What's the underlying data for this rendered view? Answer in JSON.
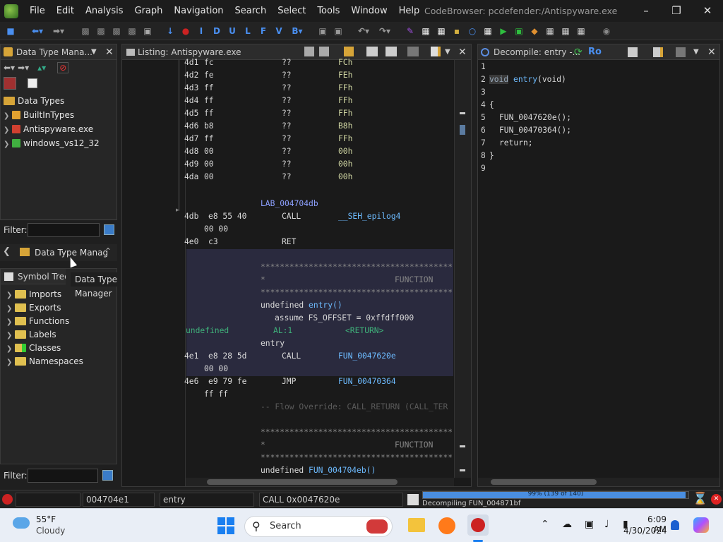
{
  "menubar": {
    "items": [
      "File",
      "Edit",
      "Analysis",
      "Graph",
      "Navigation",
      "Search",
      "Select",
      "Tools",
      "Window",
      "Help"
    ],
    "window_title": "CodeBrowser: pcdefender:/Antispyware.exe"
  },
  "data_type_panel": {
    "title": "Data Type Mana...",
    "root": "Data Types",
    "items": [
      "BuiltInTypes",
      "Antispyware.exe",
      "windows_vs12_32"
    ],
    "filter_label": "Filter:",
    "tab_label": "Data Type Manag",
    "tooltip": "Data Type Manager"
  },
  "symbol_tree": {
    "title": "Symbol Tree",
    "items": [
      "Imports",
      "Exports",
      "Functions",
      "Labels",
      "Classes",
      "Namespaces"
    ],
    "filter_label": "Filter:"
  },
  "listing": {
    "title": "Listing:  Antispyware.exe",
    "rows": [
      {
        "addr": "4d1",
        "bytes": "fc",
        "mn": "??",
        "op": "FCh"
      },
      {
        "addr": "4d2",
        "bytes": "fe",
        "mn": "??",
        "op": "FEh"
      },
      {
        "addr": "4d3",
        "bytes": "ff",
        "mn": "??",
        "op": "FFh"
      },
      {
        "addr": "4d4",
        "bytes": "ff",
        "mn": "??",
        "op": "FFh"
      },
      {
        "addr": "4d5",
        "bytes": "ff",
        "mn": "??",
        "op": "FFh"
      },
      {
        "addr": "4d6",
        "bytes": "b8",
        "mn": "??",
        "op": "B8h"
      },
      {
        "addr": "4d7",
        "bytes": "ff",
        "mn": "??",
        "op": "FFh"
      },
      {
        "addr": "4d8",
        "bytes": "00",
        "mn": "??",
        "op": "00h"
      },
      {
        "addr": "4d9",
        "bytes": "00",
        "mn": "??",
        "op": "00h"
      },
      {
        "addr": "4da",
        "bytes": "00",
        "mn": "??",
        "op": "00h"
      }
    ],
    "label1": "LAB_004704db",
    "call1": {
      "addr": "4db",
      "bytes": "e8 55 40",
      "bytes2": "00 00",
      "mn": "CALL",
      "op": "__SEH_epilog4"
    },
    "ret": {
      "addr": "4e0",
      "bytes": "c3",
      "mn": "RET"
    },
    "stars": "********************************************",
    "function_word": "FUNCTION",
    "sig_type": "undefined",
    "sig_name": "entry()",
    "assume": "assume FS_OFFSET = 0xffdff000",
    "ret_type": "undefined",
    "ret_reg": "AL:1",
    "ret_tag": "<RETURN>",
    "entry_label": "entry",
    "call2": {
      "addr": "4e1",
      "bytes": "e8 28 5d",
      "bytes2": "00 00",
      "mn": "CALL",
      "op": "FUN_0047620e"
    },
    "jmp": {
      "addr": "4e6",
      "bytes": "e9 79 fe",
      "bytes2": "ff ff",
      "mn": "JMP",
      "op": "FUN_00470364"
    },
    "flow_override": "-- Flow Override: CALL_RETURN (CALL_TER",
    "sig2_type": "undefined",
    "sig2_name": "FUN_004704eb()"
  },
  "decompile": {
    "title": "Decompile: entry -...",
    "ro": "Ro",
    "line_numbers": [
      "1",
      "2",
      "3",
      "4",
      "5",
      "6",
      "7",
      "8",
      "9"
    ],
    "void_kw": "void",
    "fn_name": "entry",
    "params": "(void)",
    "brace_open": "{",
    "call1": "FUN_0047620e();",
    "call2": "FUN_00470364();",
    "ret": "return;",
    "brace_close": "}"
  },
  "status": {
    "address": "004704e1",
    "function": "entry",
    "instruction": "CALL 0x0047620e",
    "progress_text": "99% (139 of 140)",
    "progress": 0.99,
    "task": "Decompiling FUN_004871bf"
  },
  "taskbar": {
    "temp": "55°F",
    "weather": "Cloudy",
    "search": "Search",
    "time": "6:09 AM",
    "date": "4/30/2024"
  },
  "colors": {
    "accent": "#3d7ee0",
    "label": "#8da0ff",
    "function": "#6dbbff",
    "comment": "#6b6b6b"
  }
}
